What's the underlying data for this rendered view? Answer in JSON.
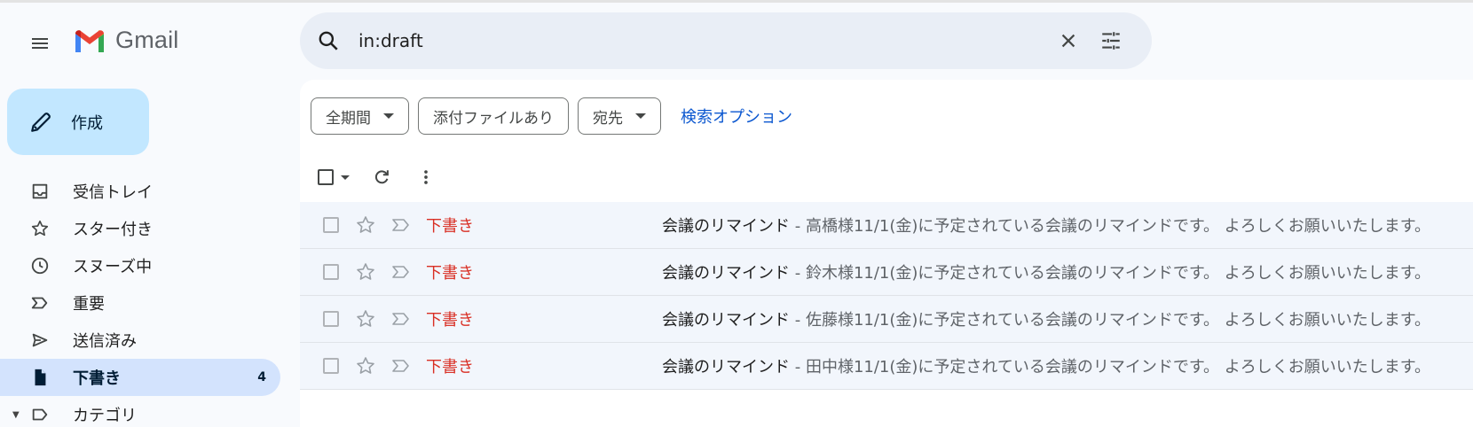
{
  "app": {
    "name": "Gmail"
  },
  "compose": {
    "label": "作成"
  },
  "sidebar": {
    "items": [
      {
        "label": "受信トレイ",
        "icon": "inbox-icon"
      },
      {
        "label": "スター付き",
        "icon": "star-icon"
      },
      {
        "label": "スヌーズ中",
        "icon": "clock-icon"
      },
      {
        "label": "重要",
        "icon": "important-icon"
      },
      {
        "label": "送信済み",
        "icon": "send-icon"
      },
      {
        "label": "下書き",
        "icon": "draft-icon",
        "count": "4",
        "active": true
      },
      {
        "label": "カテゴリ",
        "icon": "label-icon"
      }
    ]
  },
  "search": {
    "value": "in:draft"
  },
  "filters": {
    "chips": [
      {
        "label": "全期間",
        "dropdown": true
      },
      {
        "label": "添付ファイルあり",
        "dropdown": false
      },
      {
        "label": "宛先",
        "dropdown": true
      }
    ],
    "advanced_link": "検索オプション"
  },
  "messages": [
    {
      "sender": "下書き",
      "subject": "会議のリマインド",
      "snippet": " - 高橋様11/1(金)に予定されている会議のリマインドです。 よろしくお願いいたします。"
    },
    {
      "sender": "下書き",
      "subject": "会議のリマインド",
      "snippet": " - 鈴木様11/1(金)に予定されている会議のリマインドです。 よろしくお願いいたします。"
    },
    {
      "sender": "下書き",
      "subject": "会議のリマインド",
      "snippet": " - 佐藤様11/1(金)に予定されている会議のリマインドです。 よろしくお願いいたします。"
    },
    {
      "sender": "下書き",
      "subject": "会議のリマインド",
      "snippet": " - 田中様11/1(金)に予定されている会議のリマインドです。 よろしくお願いいたします。"
    }
  ],
  "colors": {
    "accent": "#0b57d0",
    "compose_bg": "#c2e7ff",
    "active_nav_bg": "#d3e3fd",
    "draft_label": "#d93025",
    "search_bg": "#e9eef6"
  }
}
